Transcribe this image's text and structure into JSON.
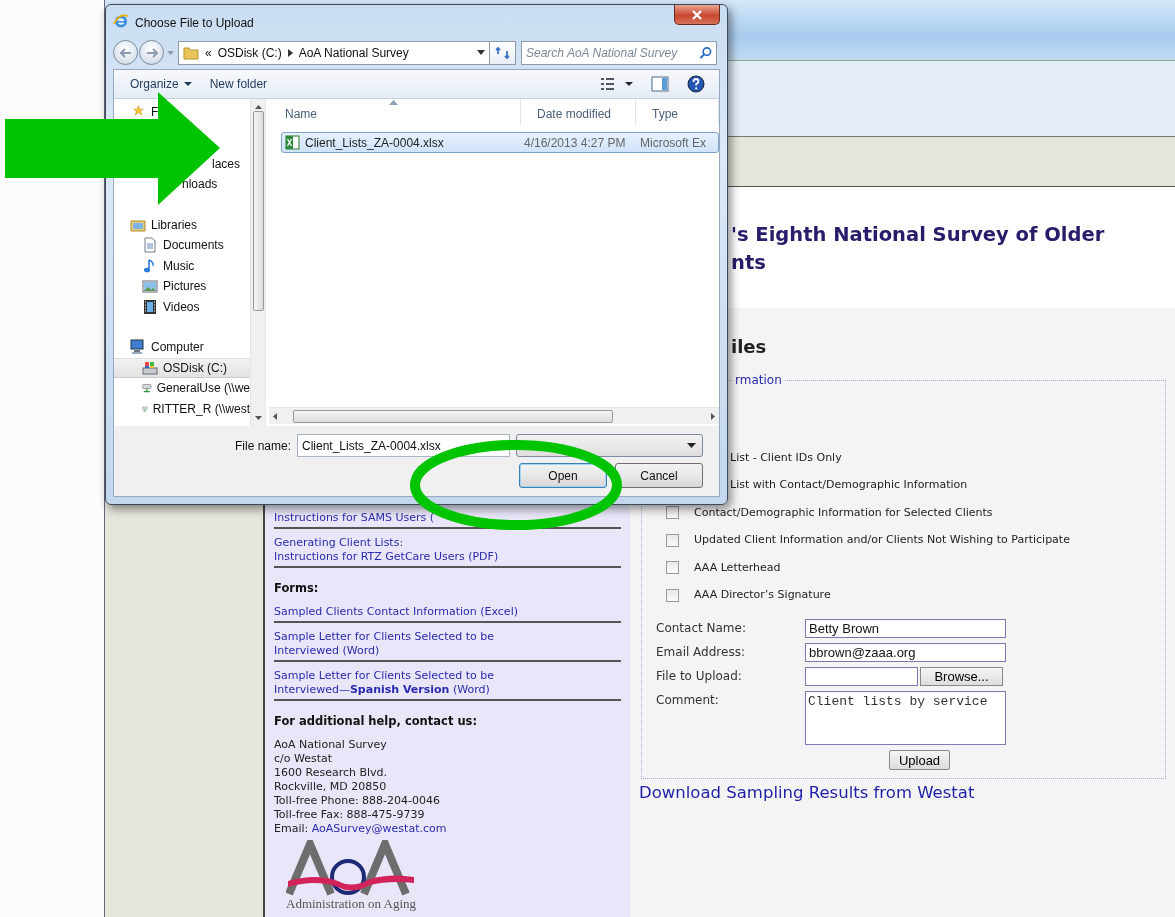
{
  "dialog": {
    "title": "Choose File to Upload",
    "breadcrumb": {
      "overflow": "«",
      "segments": [
        "OSDisk (C:)",
        "AoA National Survey"
      ]
    },
    "search": {
      "placeholder": "Search AoA National Survey"
    },
    "toolbar": [
      {
        "label": "Organize",
        "menu": true
      },
      {
        "label": "New folder",
        "menu": false
      }
    ],
    "nav": [
      {
        "label": "F",
        "selected": false,
        "children": [
          {
            "label": "laces",
            "selected": false
          },
          {
            "label": "nloads",
            "selected": false
          }
        ]
      },
      {
        "label": "Libraries",
        "selected": false,
        "children": [
          {
            "label": "Documents",
            "selected": false
          },
          {
            "label": "Music",
            "selected": false
          },
          {
            "label": "Pictures",
            "selected": false
          },
          {
            "label": "Videos",
            "selected": false
          }
        ]
      },
      {
        "label": "Computer",
        "selected": false,
        "children": [
          {
            "label": "OSDisk (C:)",
            "selected": true
          },
          {
            "label": "GeneralUse (\\\\we",
            "selected": false
          },
          {
            "label": "RITTER_R (\\\\west",
            "selected": false
          }
        ]
      }
    ],
    "columns": [
      "Name",
      "Date modified",
      "Type"
    ],
    "files": [
      {
        "name": "Client_Lists_ZA-0004.xlsx",
        "date_modified": "4/16/2013 4:27 PM",
        "type": "Microsoft Ex",
        "selected": true
      }
    ],
    "file_name_label": "File name:",
    "file_name": "Client_Lists_ZA-0004.xlsx",
    "buttons": [
      {
        "label": "Open",
        "default": true
      },
      {
        "label": "Cancel",
        "default": false
      }
    ]
  },
  "page": {
    "heading_lines": [
      "'s Eighth National Survey of Older",
      "nts"
    ],
    "section_title": "iles",
    "legend": "rmation",
    "upload_options": [
      {
        "kind": "cut",
        "label": "List - Client IDs Only"
      },
      {
        "kind": "cut",
        "label": "List with Contact/Demographic Information"
      },
      {
        "kind": "checkbox",
        "label": "Contact/Demographic Information for Selected Clients",
        "checked": false
      },
      {
        "kind": "checkbox",
        "label": "Updated Client Information and/or Clients Not Wishing to Participate",
        "checked": false
      },
      {
        "kind": "checkbox",
        "label": "AAA Letterhead",
        "checked": false
      },
      {
        "kind": "checkbox",
        "label": "AAA Director’s Signature",
        "checked": false
      }
    ],
    "form": [
      {
        "kind": "text",
        "label": "Contact Name:",
        "value": "Betty Brown"
      },
      {
        "kind": "text",
        "label": "Email Address:",
        "value": "bbrown@zaaa.org"
      },
      {
        "kind": "file",
        "label": "File to Upload:",
        "button": "Browse..."
      },
      {
        "kind": "textarea",
        "label": "Comment:",
        "value": "Client lists by service"
      }
    ],
    "submit": "Upload",
    "download_link": "Download Sampling Results from Westat"
  },
  "sidebar": {
    "blocks": [
      {
        "kind": "link",
        "lines": [
          "Instructions for SAMS Users ("
        ]
      },
      {
        "kind": "link",
        "lines": [
          "Generating Client Lists:",
          "Instructions for RTZ GetCare Users (PDF)"
        ]
      },
      {
        "kind": "heading",
        "lines": [
          "Forms:"
        ]
      },
      {
        "kind": "link",
        "lines": [
          "Sampled Clients Contact Information (Excel)"
        ]
      },
      {
        "kind": "link",
        "lines": [
          "Sample Letter for Clients Selected to be",
          "Interviewed (Word)"
        ]
      },
      {
        "kind": "link",
        "lines": [
          "Sample Letter for Clients Selected to be",
          "Interviewed—**Spanish Version** (Word)"
        ]
      },
      {
        "kind": "heading",
        "lines": [
          "For additional help, contact us:"
        ]
      }
    ],
    "contact": {
      "lines": [
        "AoA National Survey",
        "c/o Westat",
        "1600 Research Blvd.",
        "Rockville, MD 20850",
        "Toll-free Phone: 888-204-0046",
        "Toll-free Fax: 888-475-9739"
      ],
      "email_label": "Email:",
      "email": "AoASurvey@westat.com"
    },
    "logo": {
      "caption": "Administration on Aging"
    }
  },
  "annotations": {
    "arrow": {
      "color": "#00c400"
    },
    "ellipse": {
      "color": "#00c400"
    }
  }
}
